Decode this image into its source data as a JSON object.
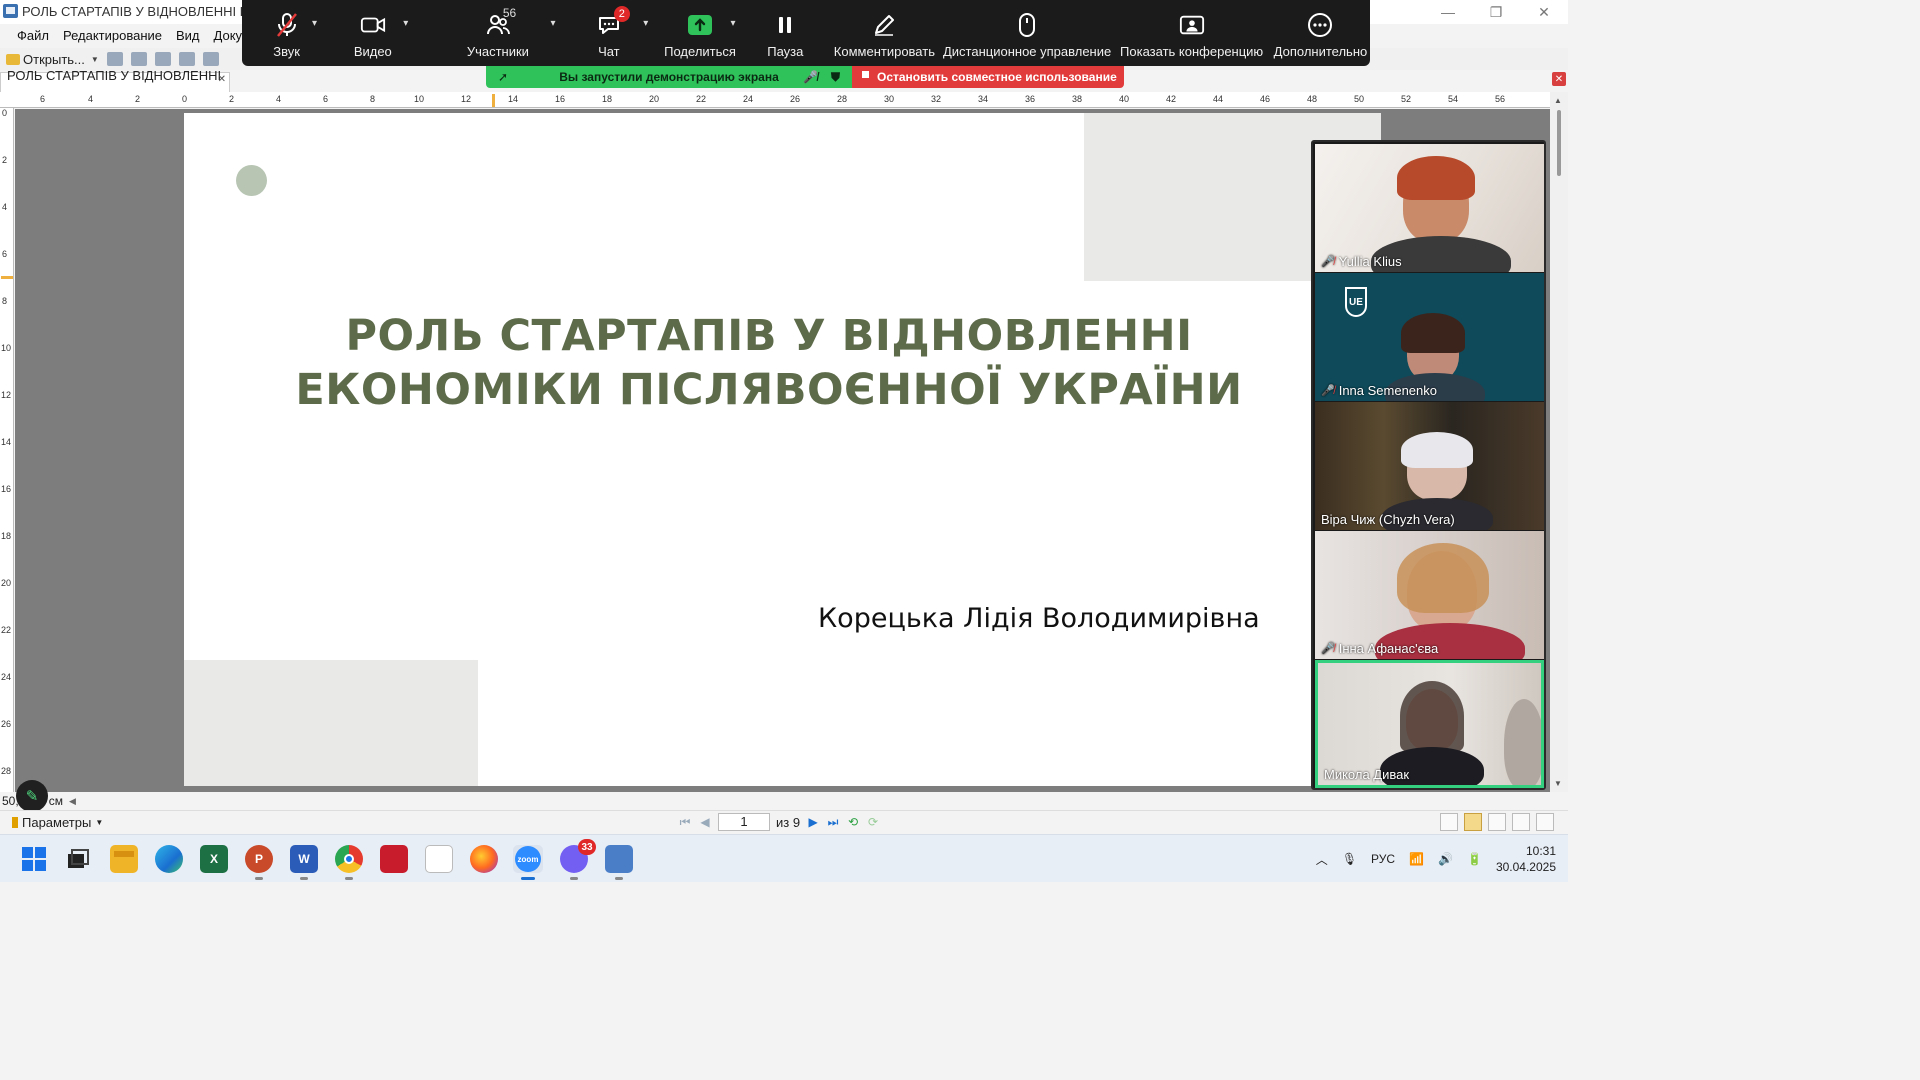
{
  "window": {
    "title": "РОЛЬ СТАРТАПІВ У ВІДНОВЛЕННІ ЕКОНОМІКИ",
    "minimize": "—",
    "restore": "❐",
    "close": "✕"
  },
  "menu": [
    "Файл",
    "Редактирование",
    "Вид",
    "Докум"
  ],
  "toolbar": {
    "open_label": "Открыть..."
  },
  "doc_tab": {
    "label": "РОЛЬ СТАРТАПІВ У ВІДНОВЛЕННІ ..."
  },
  "zoom": {
    "items": [
      {
        "label": "Звук",
        "icon": "mic-muted-icon"
      },
      {
        "label": "Видео",
        "icon": "video-icon"
      },
      {
        "label": "Участники",
        "icon": "participants-icon",
        "count": "56"
      },
      {
        "label": "Чат",
        "icon": "chat-icon",
        "badge": "2"
      },
      {
        "label": "Поделиться",
        "icon": "share-icon"
      },
      {
        "label": "Пауза",
        "icon": "pause-icon"
      },
      {
        "label": "Комментировать",
        "icon": "pen-icon"
      },
      {
        "label": "Дистанционное управление",
        "icon": "mouse-icon"
      },
      {
        "label": "Показать конференцию",
        "icon": "show-meeting-icon"
      },
      {
        "label": "Дополнительно",
        "icon": "more-icon"
      }
    ],
    "share_banner": "Вы запустили демонстрацию экрана",
    "stop_share": "Остановить совместное использование",
    "accent_green": "#2fc25b",
    "accent_red": "#e23b3b"
  },
  "slide": {
    "title_line1": "РОЛЬ СТАРТАПІВ У ВІДНОВЛЕННІ",
    "title_line2": "ЕКОНОМІКИ ПІСЛЯВОЄННОЇ УКРАЇНИ",
    "author": "Корецька Лідія Володимирівна",
    "title_color": "#5d6b4a"
  },
  "participants": [
    {
      "name": "Yullia Klius",
      "muted": true
    },
    {
      "name": "Inna Semenenko",
      "muted": true
    },
    {
      "name": "Віра Чиж (Chyzh Vera)",
      "muted": false
    },
    {
      "name": "Інна Афанас'єва",
      "muted": true
    },
    {
      "name": "Микола Дивак",
      "muted": false,
      "active": true
    }
  ],
  "status": {
    "coords": "50,      8,57 см",
    "params_label": "Параметры",
    "page_current": "1",
    "page_total": "из 9"
  },
  "taskbar": {
    "viber_badge": "33",
    "lang": "РУС",
    "time": "10:31",
    "date": "30.04.2025"
  }
}
